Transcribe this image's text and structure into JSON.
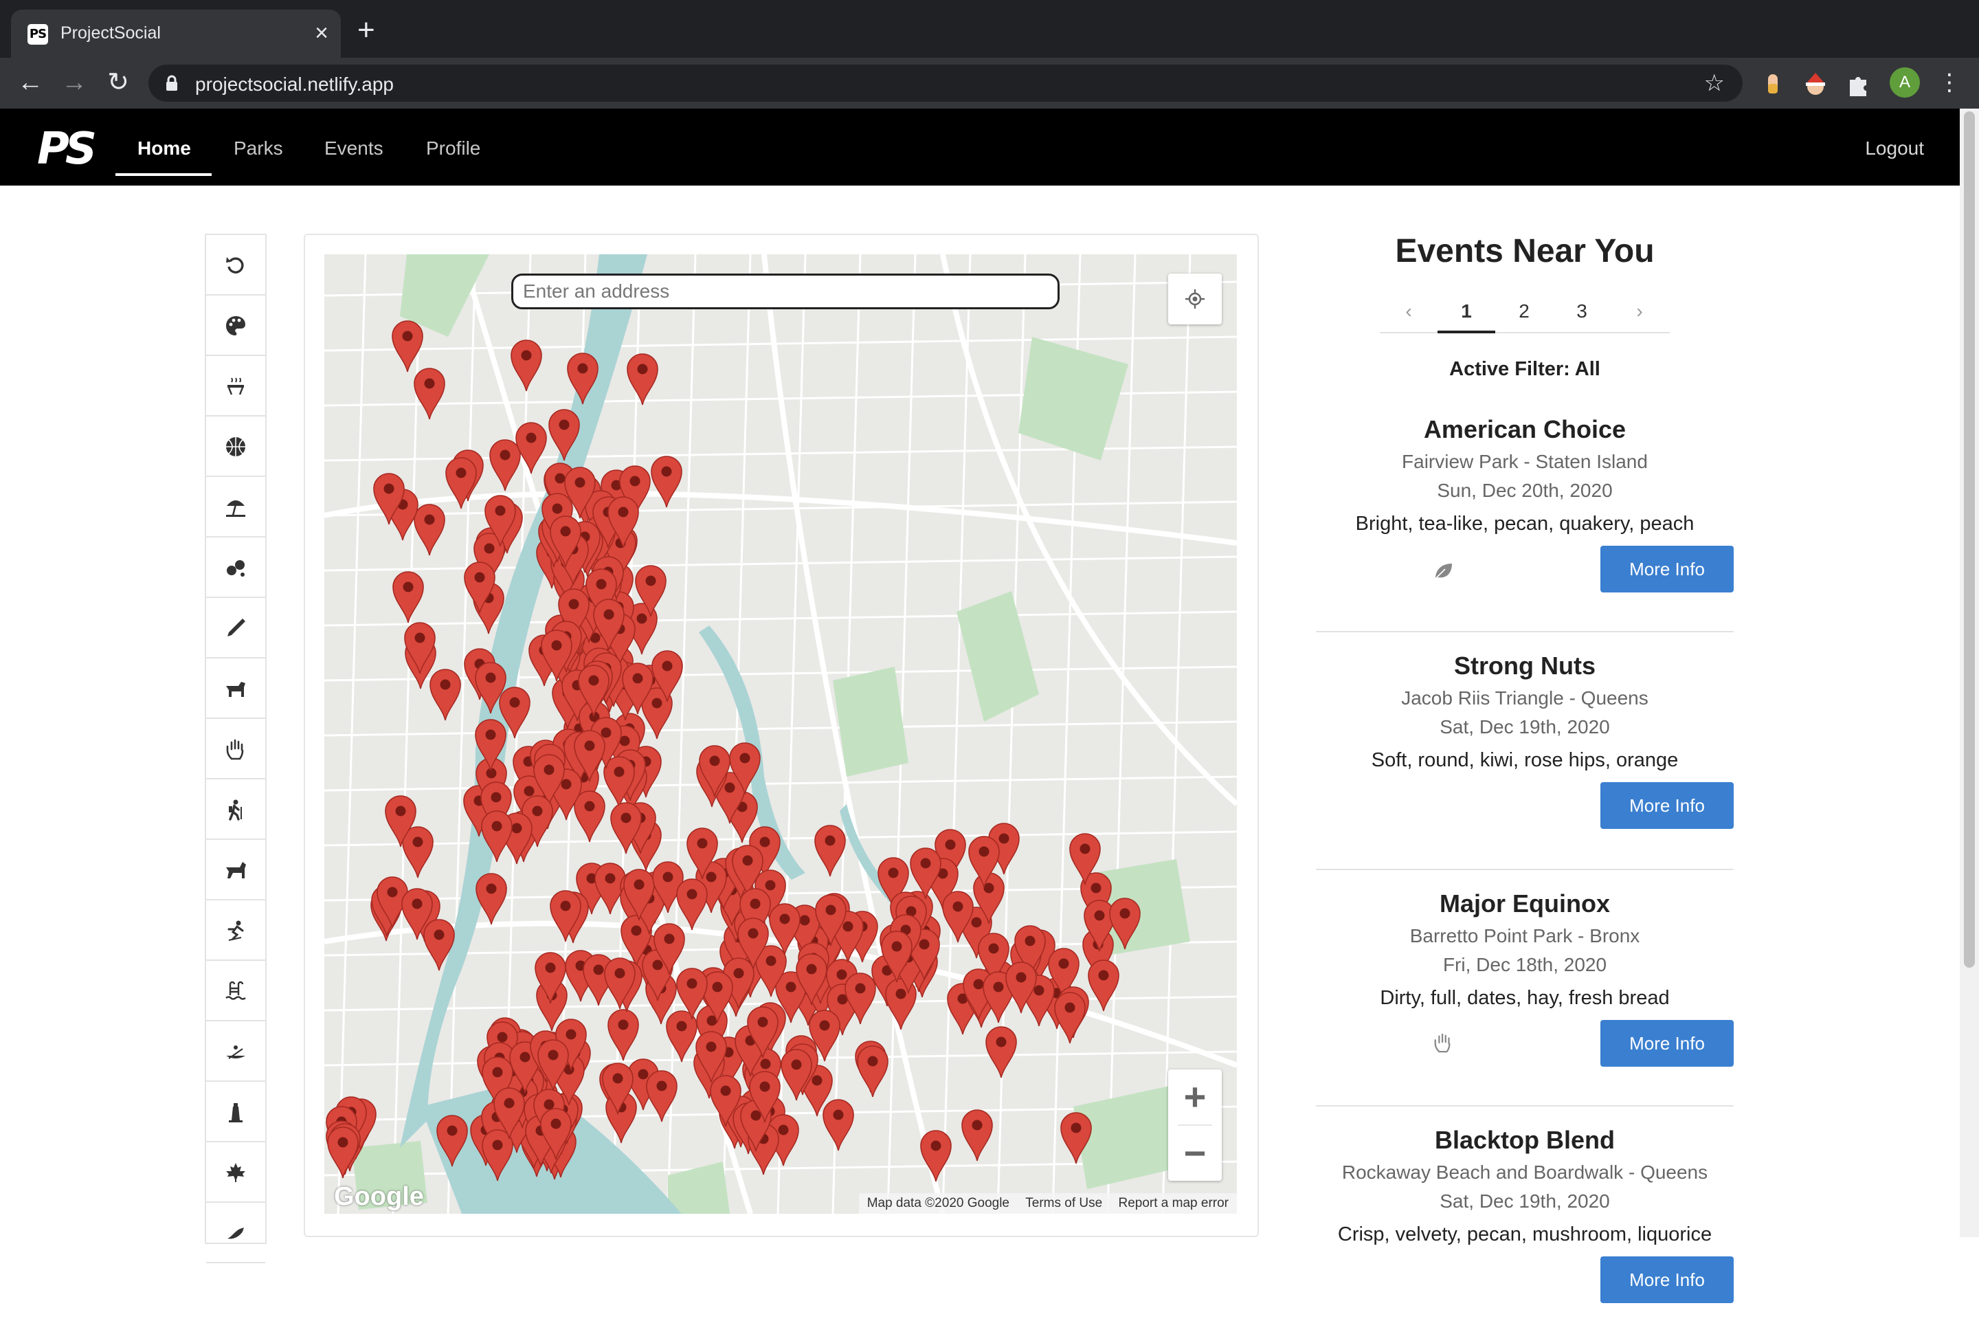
{
  "browser": {
    "tab_title": "ProjectSocial",
    "tab_favicon": "PS",
    "url": "projectsocial.netlify.app",
    "avatar_letter": "A"
  },
  "nav": {
    "logo": "PS",
    "links": [
      "Home",
      "Parks",
      "Events",
      "Profile"
    ],
    "active": "Home",
    "logout": "Logout"
  },
  "filters": [
    "reset-icon",
    "palette-icon",
    "grill-icon",
    "basketball-icon",
    "beach-umbrella-icon",
    "bocce-icon",
    "pen-icon",
    "dog-icon",
    "hand-icon",
    "hiking-icon",
    "horse-icon",
    "ice-skating-icon",
    "pool-icon",
    "kayak-icon",
    "lighthouse-icon",
    "maple-leaf-icon",
    "bird-icon"
  ],
  "map": {
    "search_placeholder": "Enter an address",
    "zoom_in": "+",
    "zoom_out": "−",
    "google_logo": "Google",
    "footer": [
      "Map data ©2020 Google",
      "Terms of Use",
      "Report a map error"
    ],
    "pin_color": "#d9463b"
  },
  "events_panel": {
    "title": "Events Near You",
    "pages": [
      "1",
      "2",
      "3"
    ],
    "prev": "‹",
    "next": "›",
    "active_page": "1",
    "active_filter": "Active Filter: All",
    "button_label": "More Info",
    "events": [
      {
        "name": "American Choice",
        "place": "Fairview Park - Staten Island",
        "date": "Sun, Dec 20th, 2020",
        "desc": "Bright, tea-like, pecan, quakery, peach",
        "icon": "leaf-icon"
      },
      {
        "name": "Strong Nuts",
        "place": "Jacob Riis Triangle - Queens",
        "date": "Sat, Dec 19th, 2020",
        "desc": "Soft, round, kiwi, rose hips, orange",
        "icon": ""
      },
      {
        "name": "Major Equinox",
        "place": "Barretto Point Park - Bronx",
        "date": "Fri, Dec 18th, 2020",
        "desc": "Dirty, full, dates, hay, fresh bread",
        "icon": "hand-icon"
      },
      {
        "name": "Blacktop Blend",
        "place": "Rockaway Beach and Boardwalk - Queens",
        "date": "Sat, Dec 19th, 2020",
        "desc": "Crisp, velvety, pecan, mushroom, liquorice",
        "icon": ""
      }
    ]
  }
}
